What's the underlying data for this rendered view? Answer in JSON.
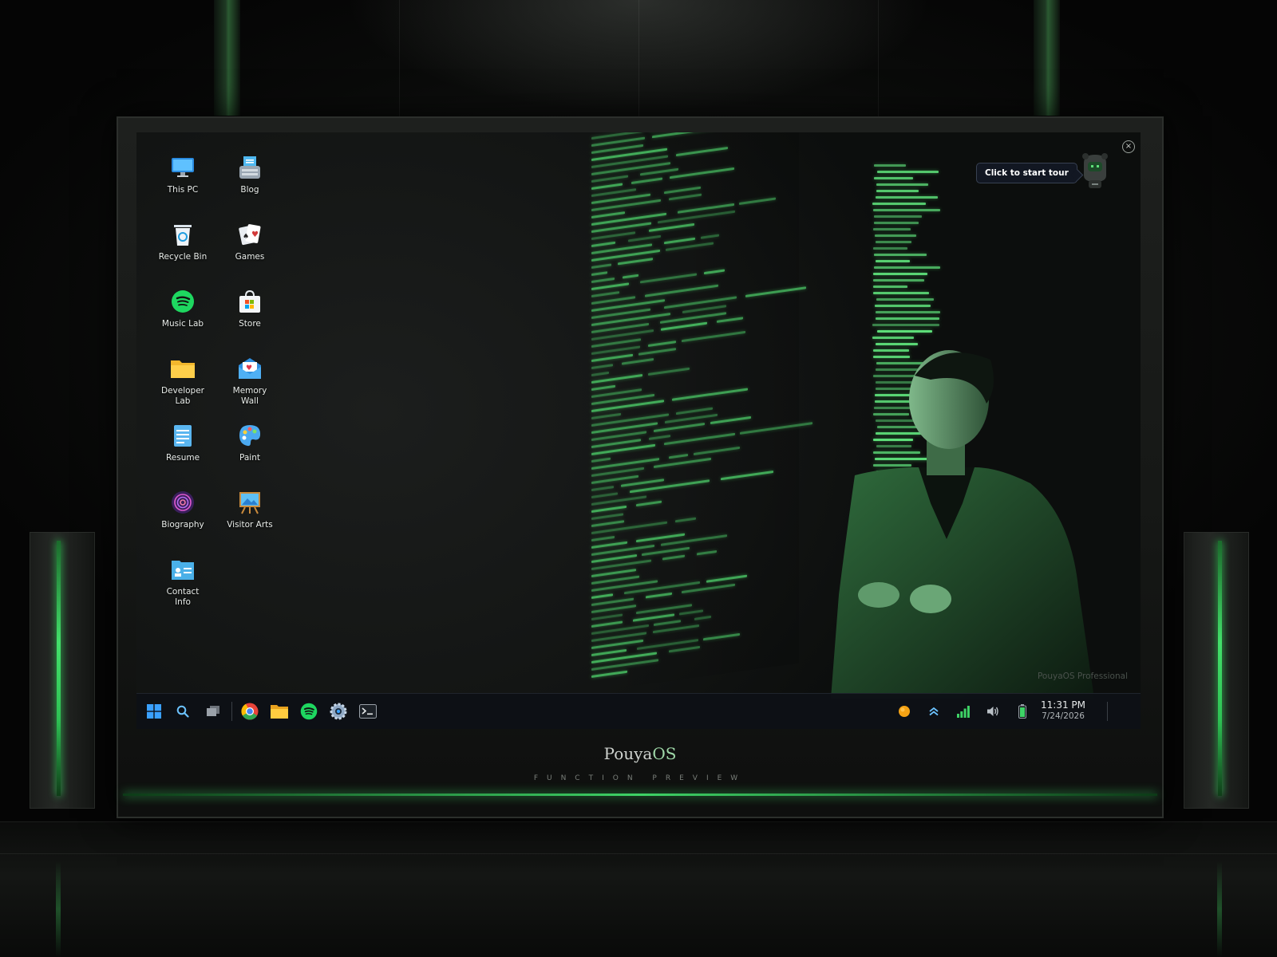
{
  "device": {
    "brand": "Pouya",
    "brand_suffix": "OS",
    "subtitle": "FUNCTION PREVIEW"
  },
  "desktop": {
    "icons": [
      {
        "label": "This PC",
        "icon": "monitor-icon"
      },
      {
        "label": "Blog",
        "icon": "typewriter-icon"
      },
      {
        "label": "Recycle Bin",
        "icon": "recycle-bin-icon"
      },
      {
        "label": "Games",
        "icon": "playing-cards-icon"
      },
      {
        "label": "Music Lab",
        "icon": "spotify-icon"
      },
      {
        "label": "Store",
        "icon": "store-bag-icon"
      },
      {
        "label": "Developer Lab",
        "icon": "folder-icon"
      },
      {
        "label": "Memory Wall",
        "icon": "envelope-heart-icon"
      },
      {
        "label": "Resume",
        "icon": "notepad-icon"
      },
      {
        "label": "Paint",
        "icon": "palette-icon"
      },
      {
        "label": "Biography",
        "icon": "fingerprint-icon"
      },
      {
        "label": "Visitor Arts",
        "icon": "easel-icon"
      },
      {
        "label": "Contact Info",
        "icon": "contact-card-icon"
      }
    ],
    "watermark": "PouyaOS Professional"
  },
  "tour": {
    "label": "Click to start tour",
    "close": "×"
  },
  "taskbar": {
    "pinned": [
      "start-icon",
      "search-icon",
      "task-view-icon",
      "chrome-icon",
      "file-explorer-icon",
      "spotify-icon",
      "settings-icon",
      "terminal-icon"
    ],
    "tray": [
      "status-dot-icon",
      "chevron-up-icon",
      "signal-icon",
      "volume-icon",
      "battery-icon"
    ],
    "time": "11:31 PM",
    "date": "7/24/2026"
  },
  "colors": {
    "accent": "#3ed366",
    "code": "#46b85f",
    "taskbar": "#0e1116"
  }
}
